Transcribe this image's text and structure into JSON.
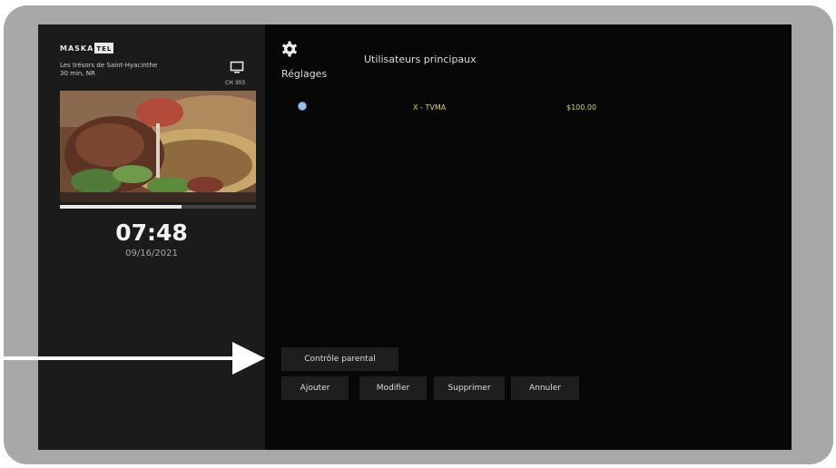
{
  "sidebar": {
    "brand_main": "MASKA",
    "brand_suffix": "TEL",
    "program_title": "Les trésors de Saint-Hyacinthe",
    "program_meta": "30 min, NR",
    "channel": "CH 303",
    "progress": 0.62,
    "time": "07:48",
    "date": "09/16/2021"
  },
  "header": {
    "section": "Réglages",
    "panel_title": "Utilisateurs principaux"
  },
  "users": [
    {
      "name": "X - TVMA",
      "amount": "$100.00",
      "selected": true
    }
  ],
  "actions": {
    "parental": "Contrôle parental",
    "add": "Ajouter",
    "edit": "Modifier",
    "delete": "Supprimer",
    "cancel": "Annuler"
  },
  "icons": {
    "settings": "gear-icon",
    "tv": "tv-icon",
    "annotation": "arrow-icon"
  },
  "colors": {
    "accent_value": "#d8d86a",
    "radio": "#9fc0e8",
    "annotation": "#ffffff"
  }
}
